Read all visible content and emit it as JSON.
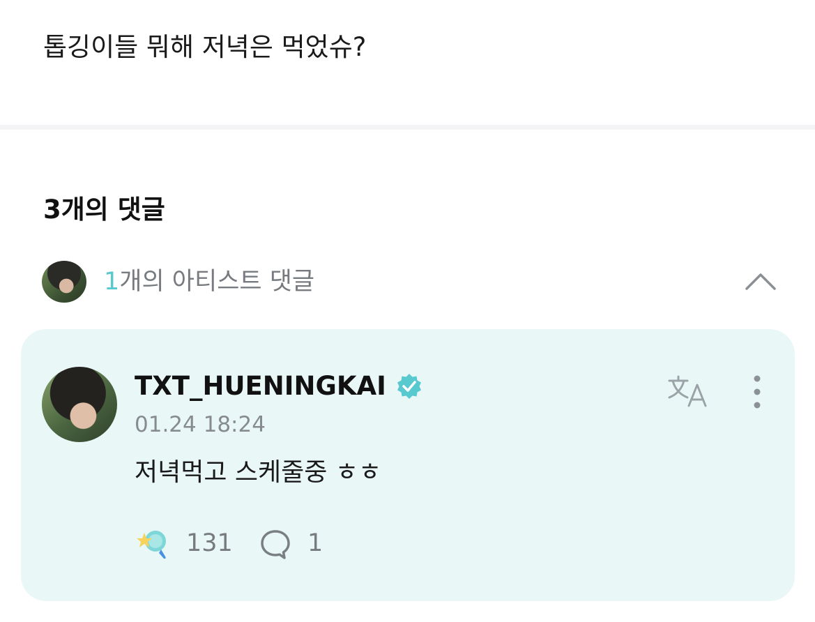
{
  "post": {
    "text": "톱깅이들 뭐해 저녁은 먹었슈?"
  },
  "comments": {
    "title": "3개의 댓글",
    "artist_section": {
      "count": "1",
      "label": "개의 아티스트 댓글",
      "expanded": true
    }
  },
  "artist_comment": {
    "username": "TXT_HUENINGKAI",
    "verified": true,
    "timestamp": "01.24 18:24",
    "text": "저녁먹고 스케줄중 ㅎㅎ",
    "likes": "131",
    "replies": "1"
  },
  "colors": {
    "accent": "#58c9cf",
    "card_background": "#e9f8f7",
    "muted_text": "#777b80"
  },
  "icons": {
    "collapse": "chevron-up-icon",
    "verified": "verified-badge-icon",
    "translate": "translate-icon",
    "more": "more-vertical-icon",
    "like": "star-light-stick-icon",
    "reply": "speech-bubble-icon"
  }
}
